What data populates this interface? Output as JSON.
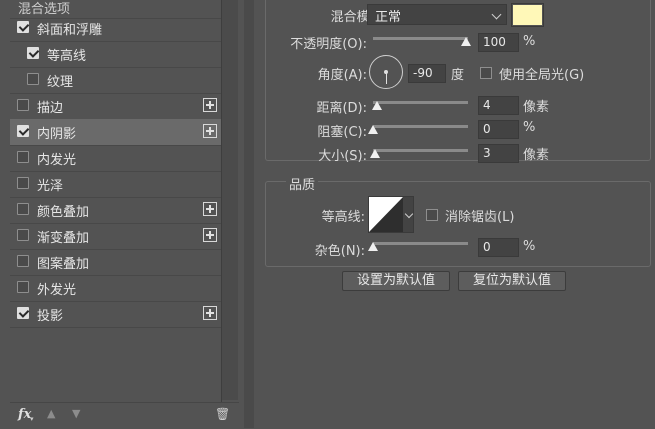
{
  "styles_panel": {
    "header_label": "混合选项",
    "items": [
      {
        "label": "斜面和浮雕",
        "checked": true,
        "has_add": false
      },
      {
        "label": "等高线",
        "checked": true,
        "has_add": false
      },
      {
        "label": "纹理",
        "checked": false,
        "has_add": false
      },
      {
        "label": "描边",
        "checked": false,
        "has_add": true
      },
      {
        "label": "内阴影",
        "checked": true,
        "has_add": true,
        "selected": true
      },
      {
        "label": "内发光",
        "checked": false,
        "has_add": false
      },
      {
        "label": "光泽",
        "checked": false,
        "has_add": false
      },
      {
        "label": "颜色叠加",
        "checked": false,
        "has_add": true
      },
      {
        "label": "渐变叠加",
        "checked": false,
        "has_add": true
      },
      {
        "label": "图案叠加",
        "checked": false,
        "has_add": false
      },
      {
        "label": "外发光",
        "checked": false,
        "has_add": false
      },
      {
        "label": "投影",
        "checked": true,
        "has_add": true
      }
    ],
    "footer": {
      "fx_label": "fx",
      "fx_caret": "▾",
      "up_icon": "▲",
      "down_icon": "▼",
      "trash_icon": "🗑"
    }
  },
  "structure": {
    "blend_mode_label": "混合模式:",
    "blend_mode_value": "正常",
    "blend_color": "#fff8b8",
    "opacity_label": "不透明度(O):",
    "opacity_value": "100",
    "opacity_unit": "%",
    "angle_label": "角度(A):",
    "angle_value": "-90",
    "angle_unit": "度",
    "global_light_label": "使用全局光(G)",
    "global_light_checked": false,
    "distance_label": "距离(D):",
    "distance_value": "4",
    "distance_unit": "像素",
    "choke_label": "阻塞(C):",
    "choke_value": "0",
    "choke_unit": "%",
    "size_label": "大小(S):",
    "size_value": "3",
    "size_unit": "像素"
  },
  "quality": {
    "section_title": "品质",
    "contour_label": "等高线:",
    "anti_alias_label": "消除锯齿(L)",
    "anti_alias_checked": false,
    "noise_label": "杂色(N):",
    "noise_value": "0",
    "noise_unit": "%"
  },
  "buttons": {
    "set_default": "设置为默认值",
    "reset_default": "复位为默认值"
  }
}
